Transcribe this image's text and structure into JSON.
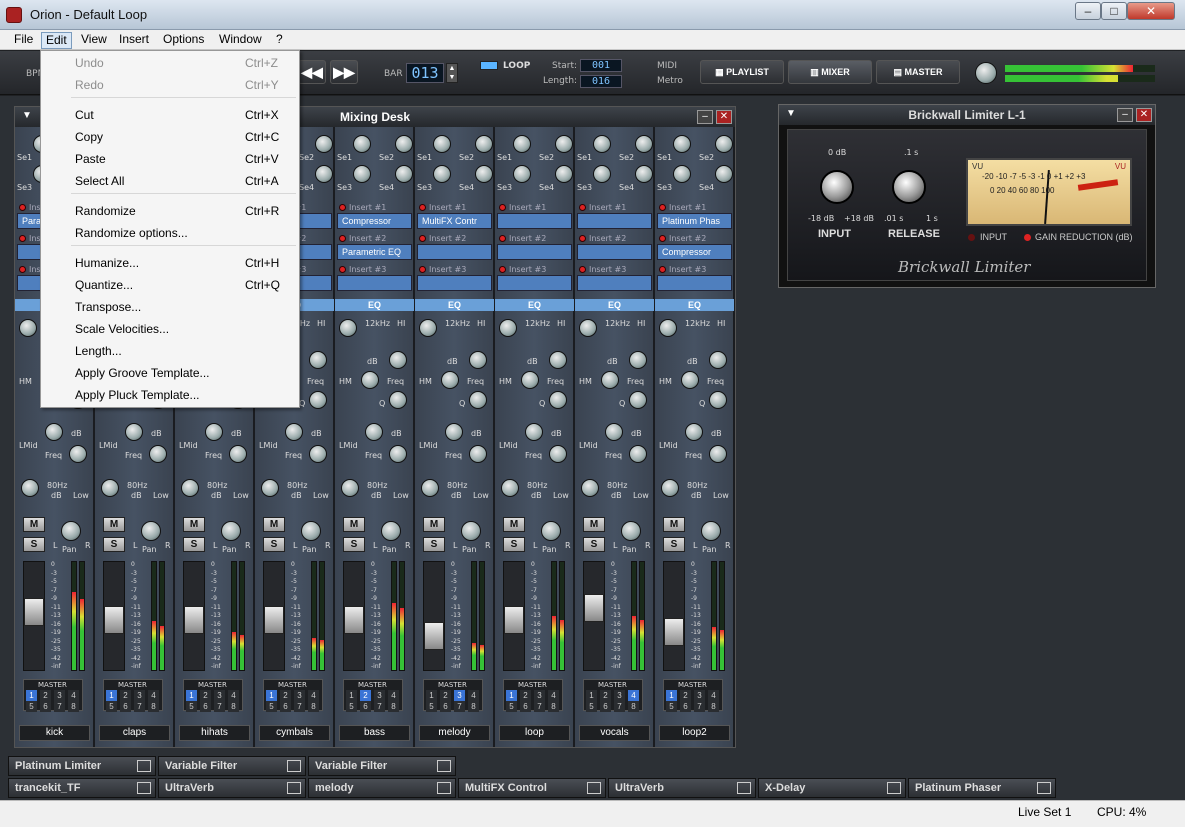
{
  "window": {
    "title": "Orion - Default Loop",
    "min": "–",
    "max": "□",
    "close": "✕"
  },
  "menubar": [
    "File",
    "Edit",
    "View",
    "Insert",
    "Options",
    "Window",
    "?"
  ],
  "edit_menu": [
    {
      "label": "Undo",
      "shortcut": "Ctrl+Z",
      "disabled": true
    },
    {
      "label": "Redo",
      "shortcut": "Ctrl+Y",
      "disabled": true
    },
    {
      "label": "Cut",
      "shortcut": "Ctrl+X"
    },
    {
      "label": "Copy",
      "shortcut": "Ctrl+C"
    },
    {
      "label": "Paste",
      "shortcut": "Ctrl+V"
    },
    {
      "label": "Select All",
      "shortcut": "Ctrl+A"
    },
    {
      "label": "Randomize",
      "shortcut": "Ctrl+R"
    },
    {
      "label": "Randomize options...",
      "shortcut": ""
    },
    {
      "label": "Humanize...",
      "shortcut": "Ctrl+H"
    },
    {
      "label": "Quantize...",
      "shortcut": "Ctrl+Q"
    },
    {
      "label": "Transpose...",
      "shortcut": ""
    },
    {
      "label": "Scale Velocities...",
      "shortcut": ""
    },
    {
      "label": "Length...",
      "shortcut": ""
    },
    {
      "label": "Apply Groove Template...",
      "shortcut": ""
    },
    {
      "label": "Apply Pluck Template...",
      "shortcut": ""
    }
  ],
  "transport": {
    "bpm_label": "BPM",
    "bar_label": "BAR",
    "bar_value": "013",
    "loop_label": "LOOP",
    "start_label": "Start:",
    "start_value": "001",
    "length_label": "Length:",
    "length_value": "016",
    "midi_label": "MIDI",
    "metro_label": "Metro",
    "playlist": "PLAYLIST",
    "mixer": "MIXER",
    "master": "MASTER"
  },
  "mixing_desk": {
    "title": "Mixing Desk",
    "send_labels": [
      "Se1",
      "Se2",
      "Se3",
      "Se4"
    ],
    "insert_labels": [
      "Insert #1",
      "Insert #2",
      "Insert #3"
    ],
    "eq_label": "EQ",
    "eq_labels": {
      "hi_freq": "12kHz",
      "hi": "HI",
      "db": "dB",
      "hm": "HM",
      "freq": "Freq",
      "q": "Q",
      "lmid": "LMid",
      "lo_freq": "80Hz",
      "low": "Low"
    },
    "mute": "M",
    "solo": "S",
    "pan": "Pan",
    "left": "L",
    "right": "R",
    "master_label": "MASTER",
    "meter_scale": [
      "0",
      "-3",
      "-5",
      "-7",
      "-9",
      "-11",
      "-13",
      "-16",
      "-19",
      "-25",
      "-35",
      "-42",
      "-inf"
    ],
    "channels": [
      {
        "name": "kick",
        "inserts": [
          "Para",
          "",
          ""
        ],
        "fader": 0.55,
        "level": 0.72,
        "route": 1
      },
      {
        "name": "claps",
        "inserts": [
          "",
          "",
          ""
        ],
        "fader": 0.45,
        "level": 0.45,
        "route": 1
      },
      {
        "name": "hihats",
        "inserts": [
          "",
          "",
          ""
        ],
        "fader": 0.45,
        "level": 0.35,
        "route": 1
      },
      {
        "name": "cymbals",
        "inserts": [
          "",
          "",
          ""
        ],
        "fader": 0.45,
        "level": 0.3,
        "route": 1
      },
      {
        "name": "bass",
        "inserts": [
          "Compressor",
          "Parametric EQ",
          ""
        ],
        "fader": 0.45,
        "level": 0.62,
        "route": 2
      },
      {
        "name": "melody",
        "inserts": [
          "MultiFX Contr",
          "",
          ""
        ],
        "fader": 0.25,
        "level": 0.25,
        "route": 3
      },
      {
        "name": "loop",
        "inserts": [
          "",
          "",
          ""
        ],
        "fader": 0.45,
        "level": 0.5,
        "route": 1
      },
      {
        "name": "vocals",
        "inserts": [
          "",
          "",
          ""
        ],
        "fader": 0.6,
        "level": 0.5,
        "route": 4
      },
      {
        "name": "loop2",
        "inserts": [
          "Platinum Phas",
          "Compressor",
          ""
        ],
        "fader": 0.3,
        "level": 0.4,
        "route": 1
      }
    ]
  },
  "limiter": {
    "title": "Brickwall Limiter L-1",
    "input": "INPUT",
    "release": "RELEASE",
    "input_top": "0 dB",
    "input_min": "-18 dB",
    "input_max": "+18 dB",
    "release_top": ".1 s",
    "release_min": ".01 s",
    "release_max": "1 s",
    "vu": "VU",
    "vu_scale": "-20 -10 -7 -5 -3 -1 0 +1 +2 +3",
    "vu_scale2": "0 20 40 60 80 100",
    "input_led": "INPUT",
    "gain_led": "GAIN REDUCTION (dB)",
    "brand": "Brickwall Limiter"
  },
  "plugins_row1": [
    "Platinum Limiter",
    "Variable Filter",
    "Variable Filter"
  ],
  "plugins_row2": [
    "trancekit_TF",
    "UltraVerb",
    "melody",
    "MultiFX Control",
    "UltraVerb",
    "X-Delay",
    "Platinum Phaser"
  ],
  "status": {
    "liveset": "Live Set 1",
    "cpu": "CPU: 4%"
  }
}
